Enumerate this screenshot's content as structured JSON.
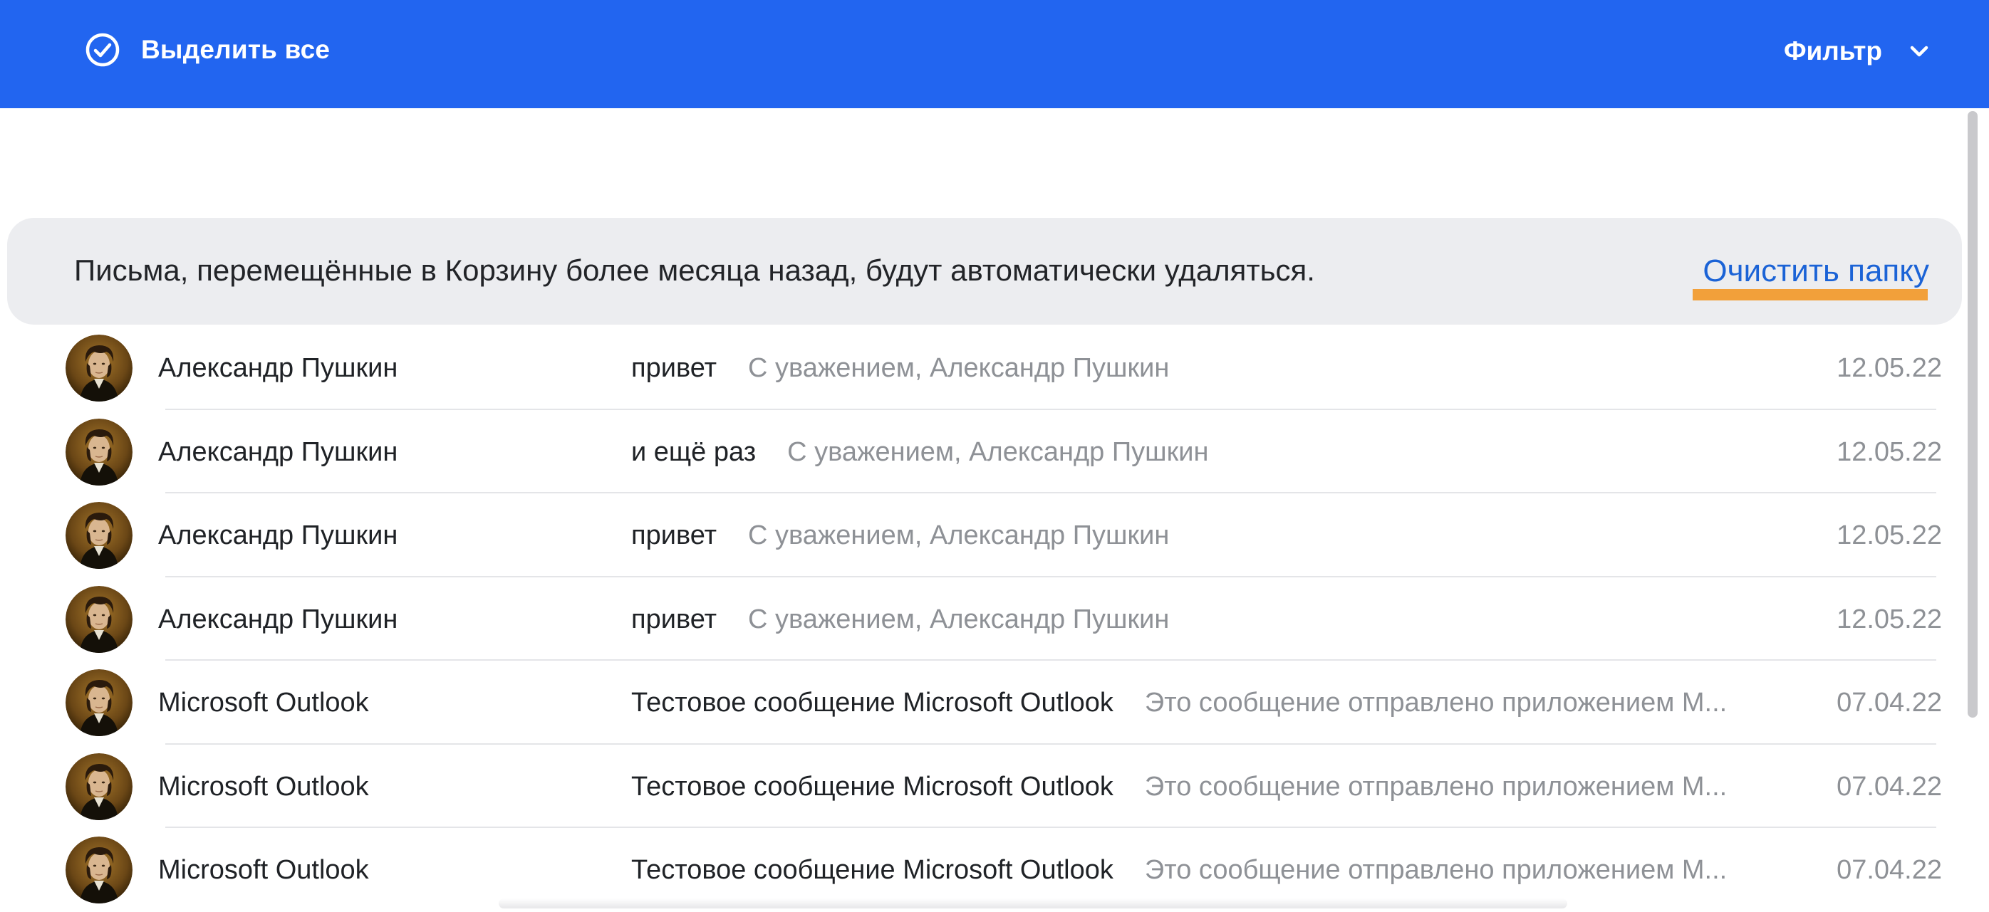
{
  "toolbar": {
    "select_all_label": "Выделить все",
    "filter_label": "Фильтр",
    "accent_color": "#2265f0"
  },
  "banner": {
    "text": "Письма, перемещённые в Корзину более месяца назад, будут автоматически удаляться.",
    "action_label": "Очистить папку",
    "action_color": "#1b63d6",
    "highlight_color": "#f2a03a"
  },
  "messages": [
    {
      "sender": "Александр Пушкин",
      "subject": "привет",
      "snippet": "С уважением, Александр Пушкин",
      "date": "12.05.22"
    },
    {
      "sender": "Александр Пушкин",
      "subject": "и ещё раз",
      "snippet": "С уважением, Александр Пушкин",
      "date": "12.05.22"
    },
    {
      "sender": "Александр Пушкин",
      "subject": "привет",
      "snippet": "С уважением, Александр Пушкин",
      "date": "12.05.22"
    },
    {
      "sender": "Александр Пушкин",
      "subject": "привет",
      "snippet": "С уважением, Александр Пушкин",
      "date": "12.05.22"
    },
    {
      "sender": "Microsoft Outlook",
      "subject": "Тестовое сообщение Microsoft Outlook",
      "snippet": "Это сообщение отправлено приложением M...",
      "date": "07.04.22"
    },
    {
      "sender": "Microsoft Outlook",
      "subject": "Тестовое сообщение Microsoft Outlook",
      "snippet": "Это сообщение отправлено приложением M...",
      "date": "07.04.22"
    },
    {
      "sender": "Microsoft Outlook",
      "subject": "Тестовое сообщение Microsoft Outlook",
      "snippet": "Это сообщение отправлено приложением M...",
      "date": "07.04.22"
    }
  ]
}
